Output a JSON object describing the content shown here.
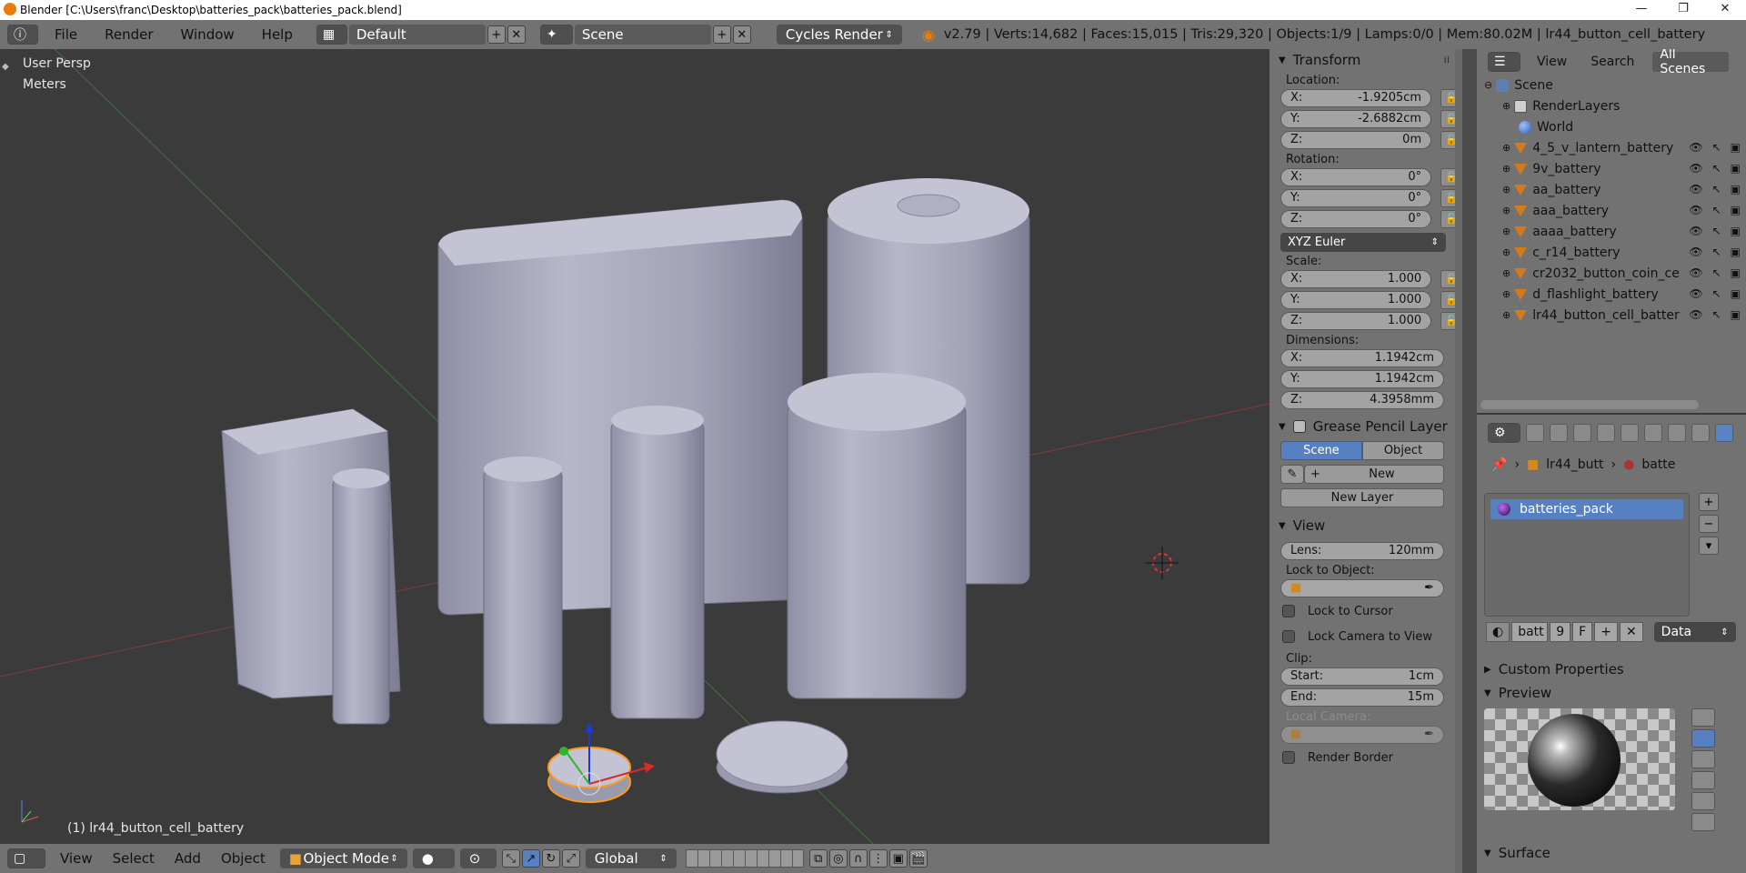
{
  "window": {
    "title": "Blender [C:\\Users\\franc\\Desktop\\batteries_pack\\batteries_pack.blend]",
    "controls": [
      "—",
      "❐",
      "✕"
    ]
  },
  "topbar": {
    "menus": [
      "File",
      "Render",
      "Window",
      "Help"
    ],
    "layout": "Default",
    "scene": "Scene",
    "engine": "Cycles Render",
    "stats": "v2.79 | Verts:14,682 | Faces:15,015 | Tris:29,320 | Objects:1/9 | Lamps:0/0 | Mem:80.02M | lr44_button_cell_battery"
  },
  "viewport": {
    "view_name": "User Persp",
    "units": "Meters",
    "active_object": "(1) lr44_button_cell_battery"
  },
  "bottombar": {
    "menus": [
      "View",
      "Select",
      "Add",
      "Object"
    ],
    "mode": "Object Mode",
    "orientation": "Global"
  },
  "properties": {
    "transform_title": "Transform",
    "location_label": "Location:",
    "location": [
      {
        "axis": "X:",
        "value": "-1.9205cm"
      },
      {
        "axis": "Y:",
        "value": "-2.6882cm"
      },
      {
        "axis": "Z:",
        "value": "0m"
      }
    ],
    "rotation_label": "Rotation:",
    "rotation": [
      {
        "axis": "X:",
        "value": "0°"
      },
      {
        "axis": "Y:",
        "value": "0°"
      },
      {
        "axis": "Z:",
        "value": "0°"
      }
    ],
    "rotation_mode": "XYZ Euler",
    "scale_label": "Scale:",
    "scale": [
      {
        "axis": "X:",
        "value": "1.000"
      },
      {
        "axis": "Y:",
        "value": "1.000"
      },
      {
        "axis": "Z:",
        "value": "1.000"
      }
    ],
    "dimensions_label": "Dimensions:",
    "dimensions": [
      {
        "axis": "X:",
        "value": "1.1942cm"
      },
      {
        "axis": "Y:",
        "value": "1.1942cm"
      },
      {
        "axis": "Z:",
        "value": "4.3958mm"
      }
    ],
    "grease_pencil_title": "Grease Pencil Layer",
    "gp_scene": "Scene",
    "gp_object": "Object",
    "gp_new": "New",
    "gp_new_layer": "New Layer",
    "view_title": "View",
    "lens_label": "Lens:",
    "lens_value": "120mm",
    "lock_to_object": "Lock to Object:",
    "lock_to_cursor": "Lock to Cursor",
    "lock_camera": "Lock Camera to View",
    "clip_label": "Clip:",
    "clip_start_label": "Start:",
    "clip_start": "1cm",
    "clip_end_label": "End:",
    "clip_end": "15m",
    "local_camera": "Local Camera:",
    "render_border": "Render Border"
  },
  "outliner": {
    "header": {
      "view": "View",
      "search": "Search",
      "scope": "All Scenes"
    },
    "scene": "Scene",
    "render_layers": "RenderLayers",
    "world": "World",
    "objects": [
      "4_5_v_lantern_battery",
      "9v_battery",
      "aa_battery",
      "aaa_battery",
      "aaaa_battery",
      "c_r14_battery",
      "cr2032_button_coin_ce",
      "d_flashlight_battery",
      "lr44_button_cell_batter"
    ]
  },
  "material": {
    "crumb_object": "lr44_butt",
    "crumb_material": "batte",
    "slot_name": "batteries_pack",
    "id_name": "batt",
    "users": "9",
    "fake": "F",
    "link": "Data",
    "custom_properties": "Custom Properties",
    "preview": "Preview",
    "surface": "Surface"
  }
}
